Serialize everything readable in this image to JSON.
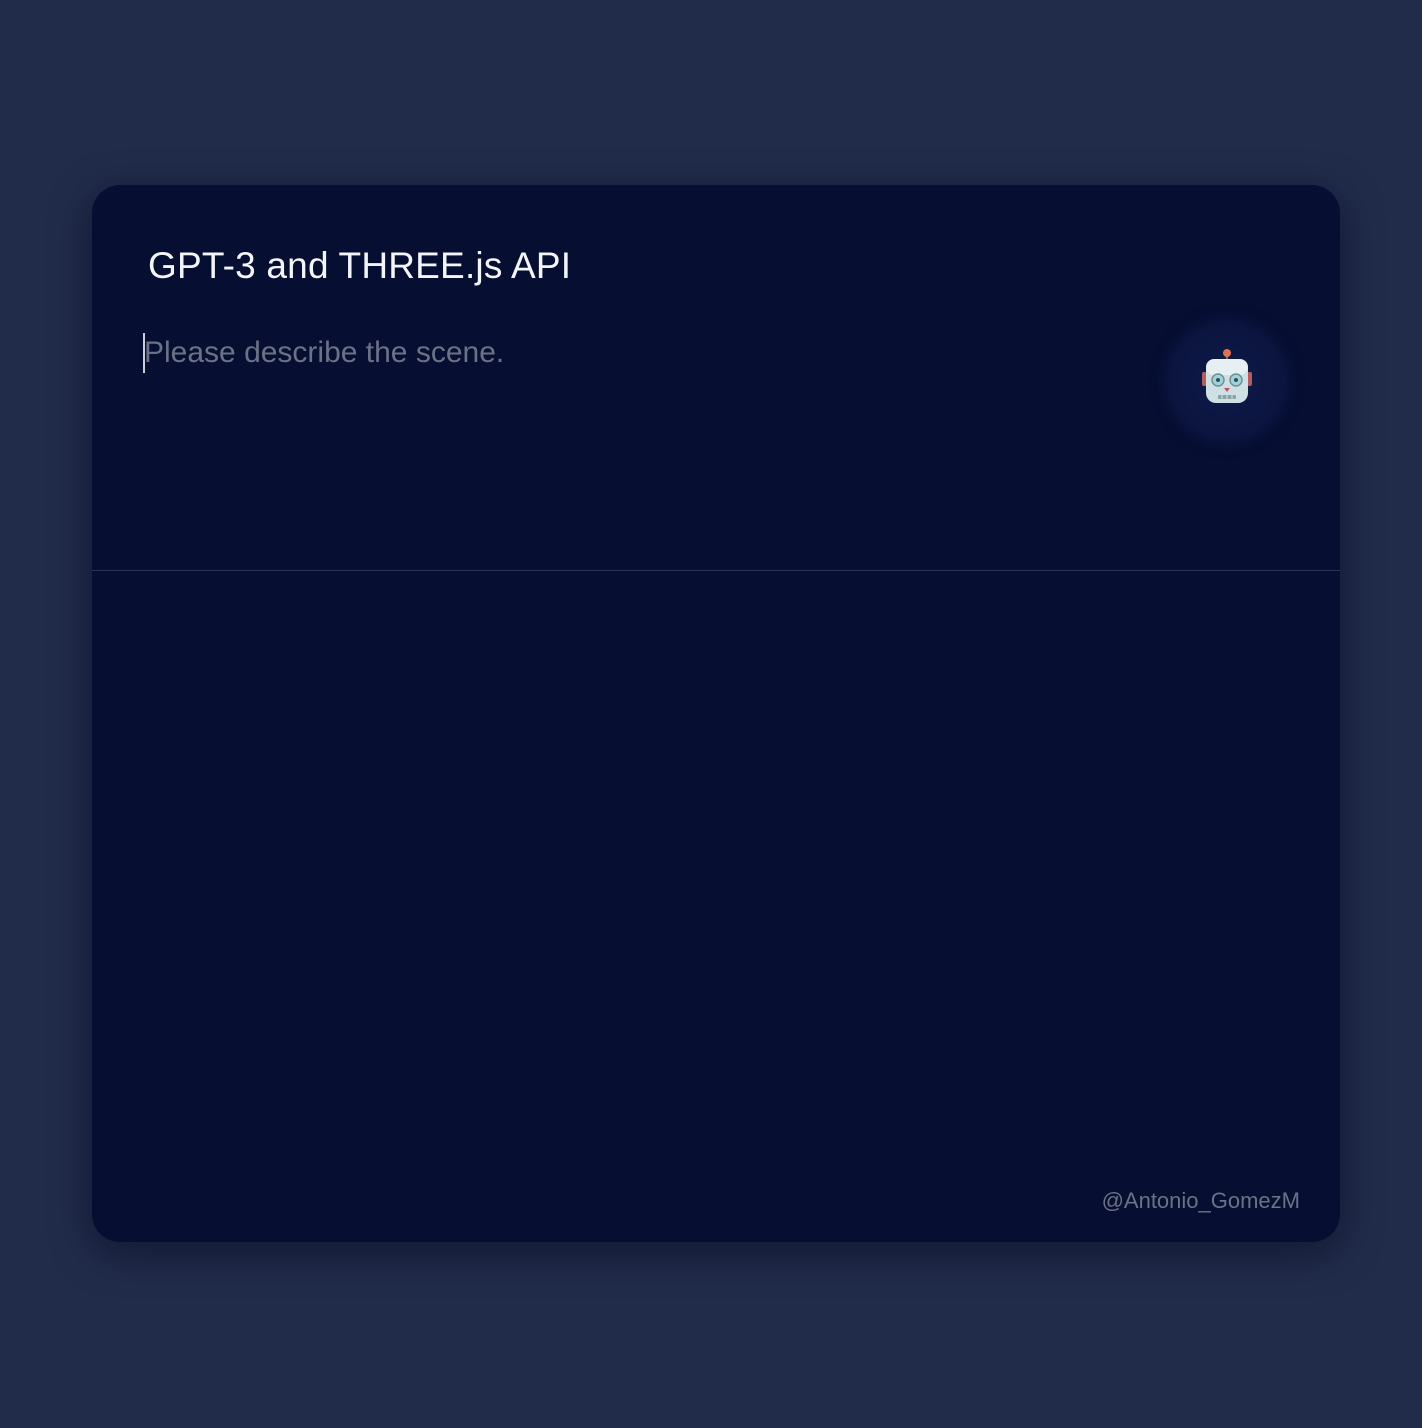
{
  "app": {
    "title": "GPT-3 and THREE.js API"
  },
  "prompt": {
    "placeholder": "Please describe the scene.",
    "value": ""
  },
  "submit": {
    "icon": "robot-icon"
  },
  "footer": {
    "credit": "@Antonio_GomezM"
  },
  "colors": {
    "page_background": "#212c4b",
    "card_background": "#060e31",
    "title_text": "#f3f5fa",
    "placeholder_text": "#6b7186",
    "divider": "#2a3457"
  }
}
